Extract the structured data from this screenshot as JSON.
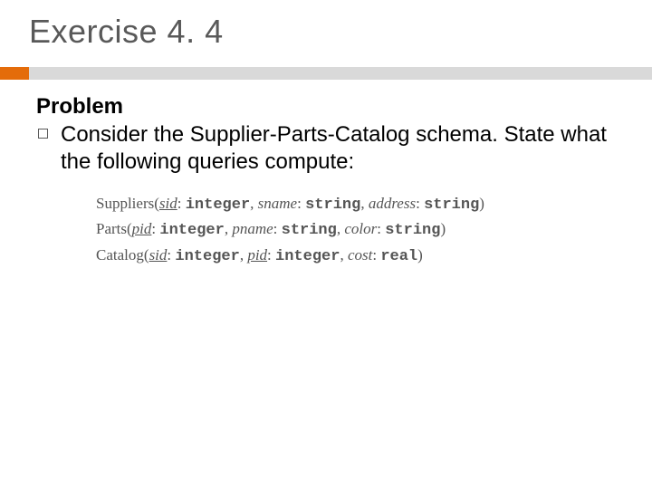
{
  "title": "Exercise 4. 4",
  "problem": {
    "heading": "Problem",
    "bullet": "Consider the Supplier-Parts-Catalog schema. State what the following queries compute:"
  },
  "schema": {
    "suppliers": {
      "name": "Suppliers",
      "key_attr": "sid",
      "key_type": "integer",
      "a2": "sname",
      "t2": "string",
      "a3": "address",
      "t3": "string"
    },
    "parts": {
      "name": "Parts",
      "key_attr": "pid",
      "key_type": "integer",
      "a2": "pname",
      "t2": "string",
      "a3": "color",
      "t3": "string"
    },
    "catalog": {
      "name": "Catalog",
      "k1": "sid",
      "kt1": "integer",
      "k2": "pid",
      "kt2": "integer",
      "a3": "cost",
      "t3": "real"
    }
  }
}
